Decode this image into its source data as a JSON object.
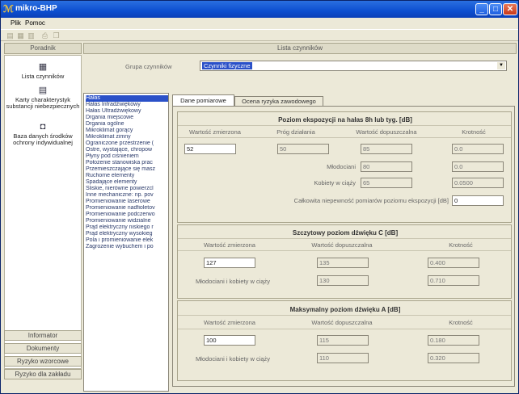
{
  "window": {
    "title": "mikro-BHP"
  },
  "menu": {
    "items": [
      "Plik",
      "Pomoc"
    ]
  },
  "sidebar": {
    "header": "Poradnik",
    "items": [
      {
        "label": "Lista czynników",
        "icon": "list-icon"
      },
      {
        "label": "Karty charakterystyk substancji niebezpiecznych",
        "icon": "card-icon"
      },
      {
        "label": "Baza danych środków ochrony indywidualnej",
        "icon": "database-icon"
      }
    ],
    "buttons": [
      "Informator",
      "Dokumenty",
      "Ryzyko wzorcowe",
      "Ryzyko dla zakładu"
    ]
  },
  "content": {
    "header": "Lista czynników",
    "group_label": "Grupa czynników",
    "group_value": "Czynniki fizyczne"
  },
  "factors": [
    "Hałas",
    "Hałas Infradźwiękowy",
    "Hałas Ultradźwiękowy",
    "Drgania miejscowe",
    "Drgania ogólne",
    "Mikroklimat gorący",
    "Mikroklimat zimny",
    "Ograniczone przestrzenie (",
    "Ostre, wystające, chropow",
    "Płyny pod ciśnieniem",
    "Położenie stanowiska prac",
    "Przemieszczające się masz",
    "Ruchome elementy",
    "Spadające elementy",
    "Śliskie, nierówne powierzcl",
    "Inne mechaniczne: np. pov",
    "Promieniowanie laserowe",
    "Promieniowanie nadfioletov",
    "Promieniowanie podczerwo",
    "Promieniowanie widzialne",
    "Prąd elektryczny niskiego r",
    "Prąd elektryczny wysokieg",
    "Pola i promieniowanie elek",
    "Zagrożenie wybuchem i po"
  ],
  "tabs": [
    "Dane pomiarowe",
    "Ocena ryzyka zawodowego"
  ],
  "section1": {
    "title": "Poziom ekspozycji na hałas 8h lub tyg. [dB]",
    "headers": [
      "Wartość zmierzona",
      "Próg działania",
      "Wartość dopuszczalna",
      "Krotność"
    ],
    "measured": "52",
    "threshold": "50",
    "allowed": "85",
    "multiple": "0.0",
    "young_label": "Młodociani",
    "young_allowed": "80",
    "young_multiple": "0.0",
    "pregnant_label": "Kobiety w ciąży",
    "pregnant_allowed": "65",
    "pregnant_multiple": "0.0500",
    "uncertainty_label": "Całkowita niepewność pomiarów poziomu ekspozycji [dB]",
    "uncertainty": "0"
  },
  "section2": {
    "title": "Szczytowy poziom dźwięku C [dB]",
    "headers": [
      "Wartość zmierzona",
      "Wartość dopuszczalna",
      "Krotność"
    ],
    "measured": "127",
    "allowed": "135",
    "multiple": "0.400",
    "row_label": "Młodociani i kobiety w ciąży",
    "row_allowed": "130",
    "row_multiple": "0.710"
  },
  "section3": {
    "title": "Maksymalny poziom dźwięku A [dB]",
    "headers": [
      "Wartość zmierzona",
      "Wartość dopuszczalna",
      "Krotność"
    ],
    "measured": "100",
    "allowed": "115",
    "multiple": "0.180",
    "row_label": "Młodociani i kobiety w ciąży",
    "row_allowed": "110",
    "row_multiple": "0.320"
  }
}
